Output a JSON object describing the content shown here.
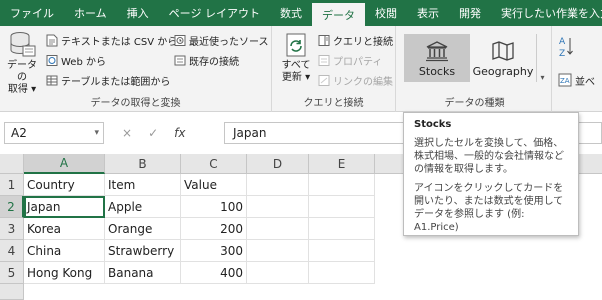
{
  "ribbon_tabs": [
    {
      "label": "ファイル",
      "active": false
    },
    {
      "label": "ホーム",
      "active": false
    },
    {
      "label": "挿入",
      "active": false
    },
    {
      "label": "ページ レイアウト",
      "active": false
    },
    {
      "label": "数式",
      "active": false
    },
    {
      "label": "データ",
      "active": true
    },
    {
      "label": "校閲",
      "active": false
    },
    {
      "label": "表示",
      "active": false
    },
    {
      "label": "開発",
      "active": false
    }
  ],
  "tell_me": "実行したい作業を入力",
  "groups": {
    "get_transform": {
      "label": "データの取得と変換",
      "get_data_line1": "データの",
      "get_data_line2": "取得",
      "text_csv": "テキストまたは CSV から",
      "web": "Web から",
      "table_range": "テーブルまたは範囲から",
      "recent_sources": "最近使ったソース",
      "existing_connections": "既存の接続"
    },
    "queries": {
      "label": "クエリと接続",
      "refresh_line1": "すべて",
      "refresh_line2": "更新",
      "queries_connections": "クエリと接続",
      "properties": "プロパティ",
      "edit_links": "リンクの編集"
    },
    "data_types": {
      "label": "データの種類",
      "stocks": "Stocks",
      "geography": "Geography"
    },
    "sort": {
      "sort_label": "並べ"
    }
  },
  "formula_bar": {
    "name_box": "A2",
    "cancel": "×",
    "enter": "✓",
    "fx": "fx",
    "value": "Japan"
  },
  "sheet": {
    "columns": [
      "A",
      "B",
      "C",
      "D",
      "E"
    ],
    "rows": [
      "1",
      "2",
      "3",
      "4",
      "5"
    ],
    "cells": [
      [
        "Country",
        "Item",
        "Value"
      ],
      [
        "Japan",
        "Apple",
        "100"
      ],
      [
        "Korea",
        "Orange",
        "200"
      ],
      [
        "China",
        "Strawberry",
        "300"
      ],
      [
        "Hong Kong",
        "Banana",
        "400"
      ]
    ]
  },
  "tooltip": {
    "title": "Stocks",
    "para1": "選択したセルを変換して、価格、株式相場、一般的な会社情報などの情報を取得します。",
    "para2": "アイコンをクリックしてカードを開いたり、または数式を使用してデータを参照します (例: A1.Price)"
  },
  "colors": {
    "accent": "#217346",
    "ribbon_bg": "#f3f3f3",
    "selected_type_bg": "#c8c8c8"
  }
}
